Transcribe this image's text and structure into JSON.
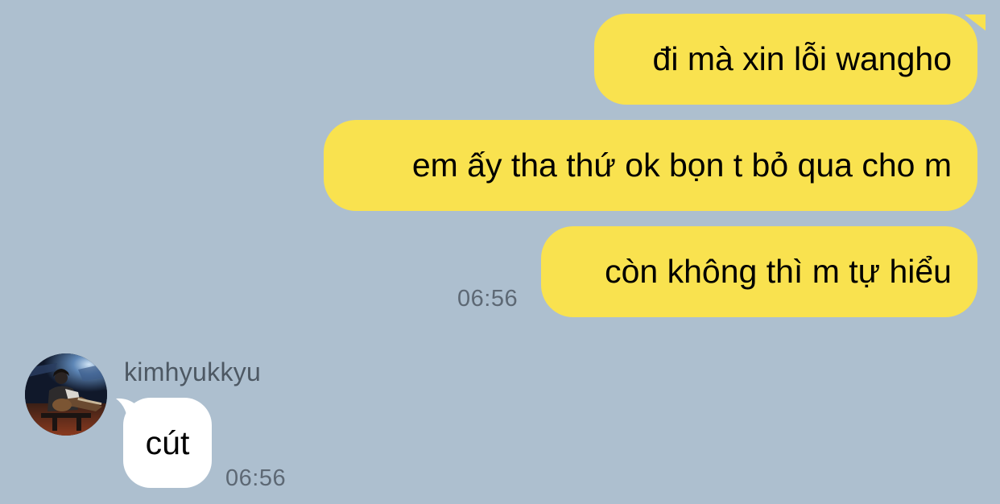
{
  "colors": {
    "background": "#adbfcf",
    "outgoing_bubble": "#f9e24f",
    "incoming_bubble": "#ffffff",
    "message_text": "#000000",
    "timestamp_text": "#5d6874",
    "sender_text": "#4d5863"
  },
  "outgoing": {
    "messages": [
      {
        "text": "đi mà xin lỗi wangho"
      },
      {
        "text": "em ấy tha thứ ok bọn t bỏ qua cho m"
      },
      {
        "text": "còn không thì m tự hiểu"
      }
    ],
    "time": "06:56"
  },
  "incoming": {
    "sender": "kimhyukkyu",
    "avatar_icon": "avatar-photo-guitarist",
    "messages": [
      {
        "text": "cút"
      }
    ],
    "time": "06:56"
  }
}
